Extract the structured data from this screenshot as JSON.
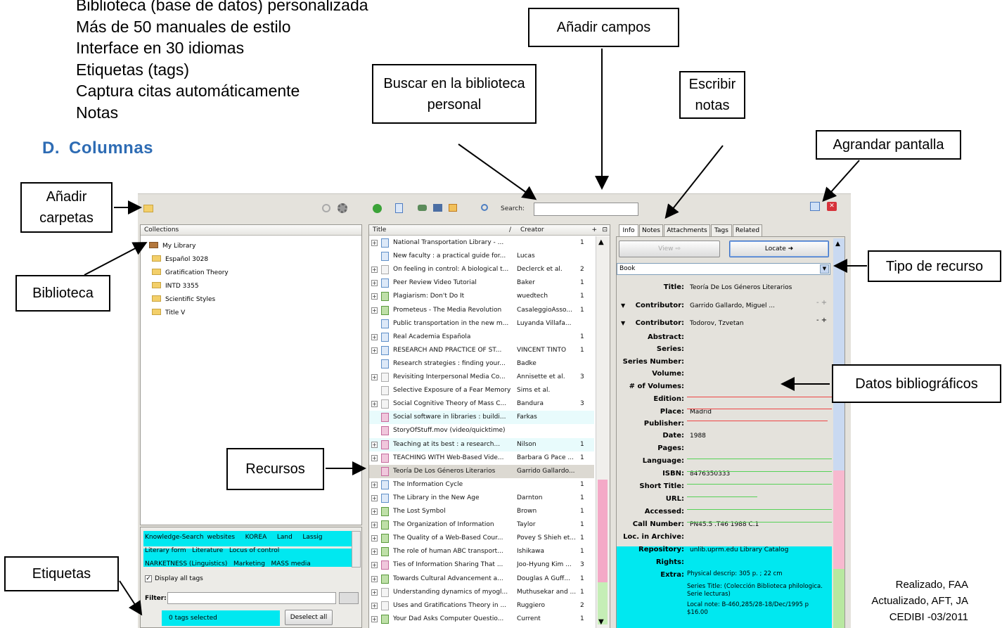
{
  "slide": {
    "top_lines": [
      "Biblioteca (base de datos) personalizada",
      "Más de 50 manuales de estilo",
      "Interface en 30 idiomas",
      "Etiquetas (tags)",
      "Captura citas automáticamente",
      "Notas"
    ],
    "heading_letter": "D.",
    "heading_text": "Columnas",
    "callouts": {
      "anadir_campos": "Añadir campos",
      "buscar": "Buscar en la biblioteca personal",
      "escribir_notas": "Escribir notas",
      "agrandar": "Agrandar pantalla",
      "anadir_carpetas": "Añadir carpetas",
      "biblioteca": "Biblioteca",
      "tipo_recurso": "Tipo de recurso",
      "datos": "Datos bibliográficos",
      "recursos": "Recursos",
      "etiquetas": "Etiquetas"
    },
    "credit": [
      "Realizado, FAA",
      "Actualizado, AFT, JA",
      "CEDIBI -03/2011"
    ]
  },
  "app": {
    "search_label": "Search:",
    "collections": {
      "header": "Collections",
      "items": [
        "My Library",
        "Español 3028",
        "Gratification Theory",
        "INTD 3355",
        "Scientific Styles",
        "Title V"
      ]
    },
    "tags": {
      "row1": [
        "Knowledge-Search websites",
        "KOREA",
        "Land",
        "Lassig"
      ],
      "row2": [
        "Literary form",
        "Literature",
        "Locus of control"
      ],
      "row3": [
        "NARKETNESS (Linguistics)",
        "Marketing",
        "MASS media"
      ],
      "display_all": "Display all tags",
      "filter": "Filter:",
      "selected": "0 tags selected",
      "deselect": "Deselect all"
    },
    "items": {
      "headers": {
        "title": "Title",
        "creator": "Creator"
      },
      "rows": [
        {
          "title": "National Transportation Library - ...",
          "creator": "",
          "n": "1"
        },
        {
          "title": "New faculty : a practical guide for...",
          "creator": "Lucas",
          "n": ""
        },
        {
          "title": "On feeling in control: A biological t...",
          "creator": "Declerck et al.",
          "n": "2"
        },
        {
          "title": "Peer Review Video Tutorial",
          "creator": "Baker",
          "n": "1"
        },
        {
          "title": "Plagiarism: Don't Do It",
          "creator": "wuedtech",
          "n": "1"
        },
        {
          "title": "Prometeus - The Media Revolution",
          "creator": "CasaleggioAsso...",
          "n": "1"
        },
        {
          "title": "Public transportation in the new m...",
          "creator": "Luyanda Villafa...",
          "n": ""
        },
        {
          "title": "Real Academia Española",
          "creator": "",
          "n": "1"
        },
        {
          "title": "RESEARCH AND PRACTICE OF ST...",
          "creator": "VINCENT TINTO",
          "n": "1"
        },
        {
          "title": "Research strategies : finding your...",
          "creator": "Badke",
          "n": ""
        },
        {
          "title": "Revisiting Interpersonal Media Co...",
          "creator": "Annisette et al.",
          "n": "3"
        },
        {
          "title": "Selective Exposure of a Fear Memory",
          "creator": "Sims et al.",
          "n": ""
        },
        {
          "title": "Social Cognitive Theory of Mass C...",
          "creator": "Bandura",
          "n": "3"
        },
        {
          "title": "Social software in libraries : buildi...",
          "creator": "Farkas",
          "n": ""
        },
        {
          "title": "StoryOfStuff.mov (video/quicktime)",
          "creator": "",
          "n": ""
        },
        {
          "title": "Teaching at its best : a research...",
          "creator": "Nilson",
          "n": "1"
        },
        {
          "title": "TEACHING WITH Web-Based Vide...",
          "creator": "Barbara G Pace ...",
          "n": "1"
        },
        {
          "title": "Teoría De Los Géneros Literarios",
          "creator": "Garrido Gallardo...",
          "n": ""
        },
        {
          "title": "The Information Cycle",
          "creator": "",
          "n": "1"
        },
        {
          "title": "The Library in the New Age",
          "creator": "Darnton",
          "n": "1"
        },
        {
          "title": "The Lost Symbol",
          "creator": "Brown",
          "n": "1"
        },
        {
          "title": "The Organization of Information",
          "creator": "Taylor",
          "n": "1"
        },
        {
          "title": "The Quality of a Web-Based Cour...",
          "creator": "Povey S Shieh et...",
          "n": "1"
        },
        {
          "title": "The role of human ABC transport...",
          "creator": "Ishikawa",
          "n": "1"
        },
        {
          "title": "Ties of Information Sharing That ...",
          "creator": "Joo-Hyung Kim ...",
          "n": "3"
        },
        {
          "title": "Towards Cultural Advancement a...",
          "creator": "Douglas A Guff...",
          "n": "1"
        },
        {
          "title": "Understanding dynamics of myogl...",
          "creator": "Muthusekar and ...",
          "n": "1"
        },
        {
          "title": "Uses and Gratifications Theory in ...",
          "creator": "Ruggiero",
          "n": "2"
        },
        {
          "title": "Your Dad Asks Computer Questio...",
          "creator": "Current",
          "n": "1"
        }
      ]
    },
    "info": {
      "tabs": [
        "Info",
        "Notes",
        "Attachments",
        "Tags",
        "Related"
      ],
      "view_btn": "View ⇨",
      "locate_btn": "Locate ➜",
      "item_type": "Book",
      "title_label": "Title:",
      "title_value": "Teoría De Los Géneros Literarios",
      "contrib_label": "Contributor:",
      "contrib1": "Garrido Gallardo, Miguel ...",
      "contrib2": "Todorov, Tzvetan",
      "labels": [
        "Abstract:",
        "Series:",
        "Series Number:",
        "Volume:",
        "# of Volumes:",
        "Edition:",
        "Place:",
        "Publisher:",
        "Date:",
        "Pages:",
        "Language:",
        "ISBN:",
        "Short Title:",
        "URL:",
        "Accessed:",
        "Call Number:",
        "Loc. in Archive:",
        "Repository:",
        "Rights:",
        "Extra:"
      ],
      "place": "Madrid",
      "date": "1988",
      "isbn": "8476350333",
      "call_number": "PN45.5 .T46 1988 C.1",
      "repository": "unlib.uprm.edu Library Catalog",
      "extra": [
        "Physical descrip: 305 p. ; 22 cm",
        "Series Title: (Colección Biblioteca philologica. Serie lecturas)",
        "Local note: B-460,285/28-18/Dec/1995 p $16.00"
      ]
    }
  }
}
